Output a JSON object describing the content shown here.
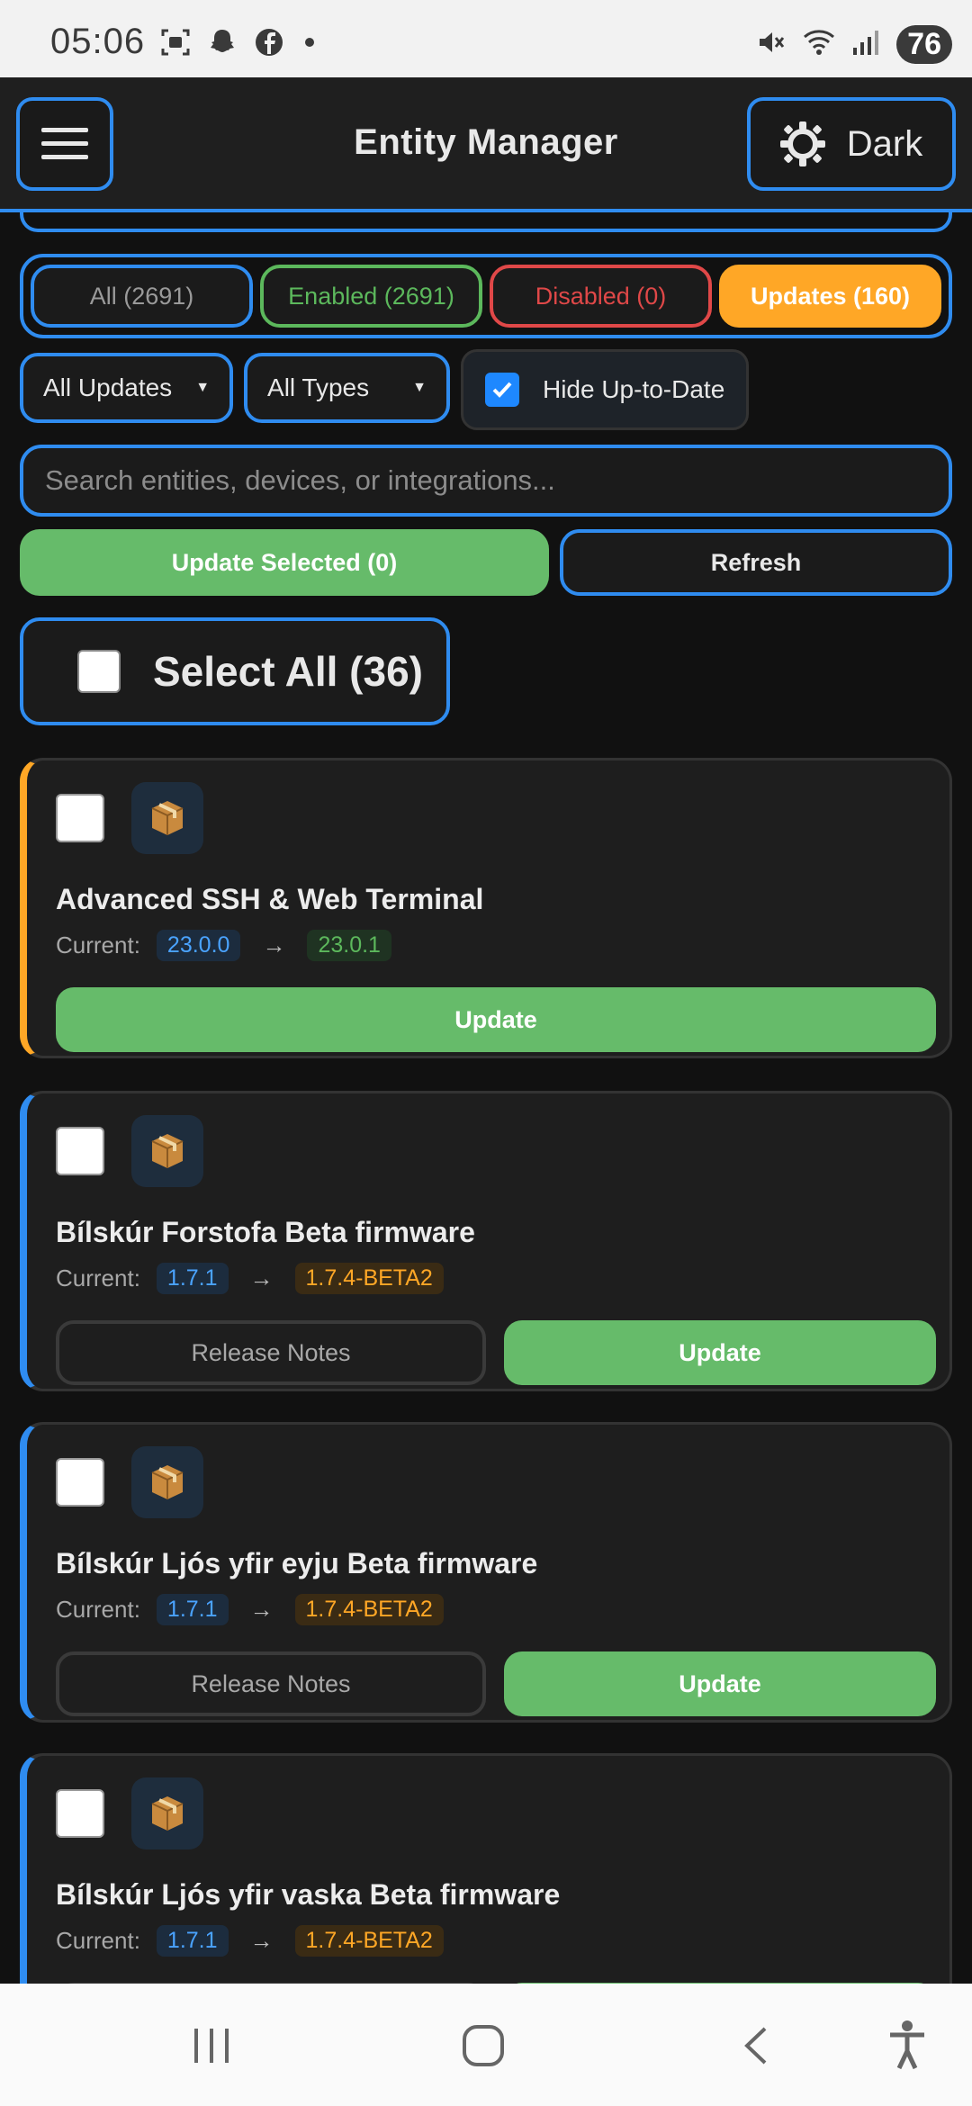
{
  "status_bar": {
    "time": "05:06",
    "battery": "76",
    "icons_left": [
      "screenshot-icon",
      "snapchat-icon",
      "facebook-icon",
      "dot-icon"
    ],
    "icons_right": [
      "mute-icon",
      "wifi-icon",
      "signal-icon"
    ]
  },
  "header": {
    "title": "Entity Manager",
    "theme_label": "Dark"
  },
  "filter_tabs": [
    {
      "label": "All (2691)",
      "state": "inactive"
    },
    {
      "label": "Enabled (2691)",
      "state": "inactive"
    },
    {
      "label": "Disabled (0)",
      "state": "inactive"
    },
    {
      "label": "Updates (160)",
      "state": "active"
    }
  ],
  "controls": {
    "update_filter": "All Updates",
    "type_filter": "All Types",
    "hide_up_to_date_label": "Hide Up-to-Date",
    "hide_up_to_date_checked": true
  },
  "search": {
    "placeholder": "Search entities, devices, or integrations...",
    "value": ""
  },
  "actions": {
    "update_selected": "Update Selected (0)",
    "refresh": "Refresh",
    "select_all": "Select All (36)"
  },
  "cards": [
    {
      "name": "Advanced SSH & Web Terminal",
      "current_label": "Current:",
      "current": "23.0.0",
      "arrow": "→",
      "latest": "23.0.1",
      "notes_label": "",
      "update_label": "Update",
      "accent": "#ffa726"
    },
    {
      "name": "Bílskúr Forstofa Beta firmware",
      "current_label": "Current:",
      "current": "1.7.1",
      "arrow": "→",
      "latest": "1.7.4-BETA2",
      "notes_label": "Release Notes",
      "update_label": "Update",
      "accent": "#2f8cf0"
    },
    {
      "name": "Bílskúr Ljós yfir eyju Beta firmware",
      "current_label": "Current:",
      "current": "1.7.1",
      "arrow": "→",
      "latest": "1.7.4-BETA2",
      "notes_label": "Release Notes",
      "update_label": "Update",
      "accent": "#2f8cf0"
    },
    {
      "name": "Bílskúr Ljós yfir vaska Beta firmware",
      "current_label": "Current:",
      "current": "1.7.1",
      "arrow": "→",
      "latest": "1.7.4-BETA2",
      "notes_label": "",
      "update_label": "",
      "accent": "#2f8cf0"
    }
  ],
  "colors": {
    "accent_blue": "#2f8cf0",
    "green": "#66bb6a",
    "orange": "#ffa726",
    "red": "#e04848",
    "background": "#111111"
  },
  "nav_bar": {
    "icons": [
      "recent-apps-icon",
      "home-icon",
      "back-icon",
      "accessibility-icon"
    ]
  }
}
